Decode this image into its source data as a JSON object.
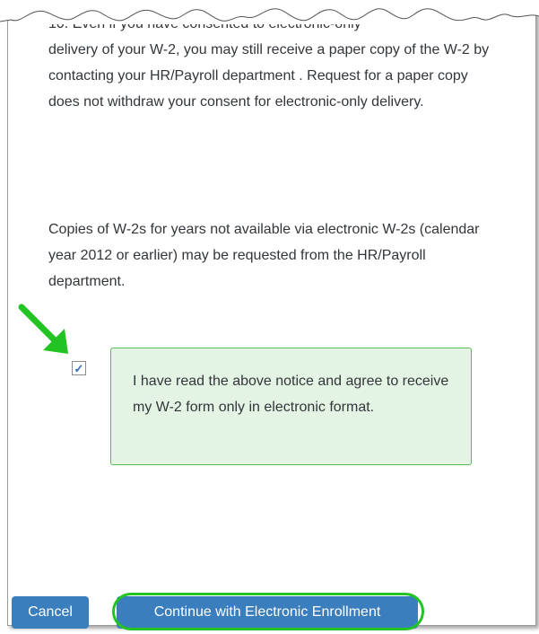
{
  "notice": {
    "partial_line": "10. Even if you have consented to electronic-only",
    "paragraph_1": "delivery of your W-2, you may still receive a paper copy of the W-2 by contacting your HR/Payroll department . Request for a paper copy does not withdraw your consent for electronic-only delivery.",
    "paragraph_2": "Copies of W-2s for years not available via electronic W-2s (calendar year 2012 or earlier) may be requested from the HR/Payroll department."
  },
  "consent": {
    "checked": true,
    "text": "I have read the above notice and agree to receive my W-2 form only in electronic format."
  },
  "buttons": {
    "cancel_label": "Cancel",
    "continue_label": "Continue with Electronic Enrollment"
  },
  "colors": {
    "button_bg": "#3a7ebe",
    "consent_bg": "#e4f4e4",
    "consent_border": "#5bb85b",
    "annotation_green": "#22c322"
  }
}
